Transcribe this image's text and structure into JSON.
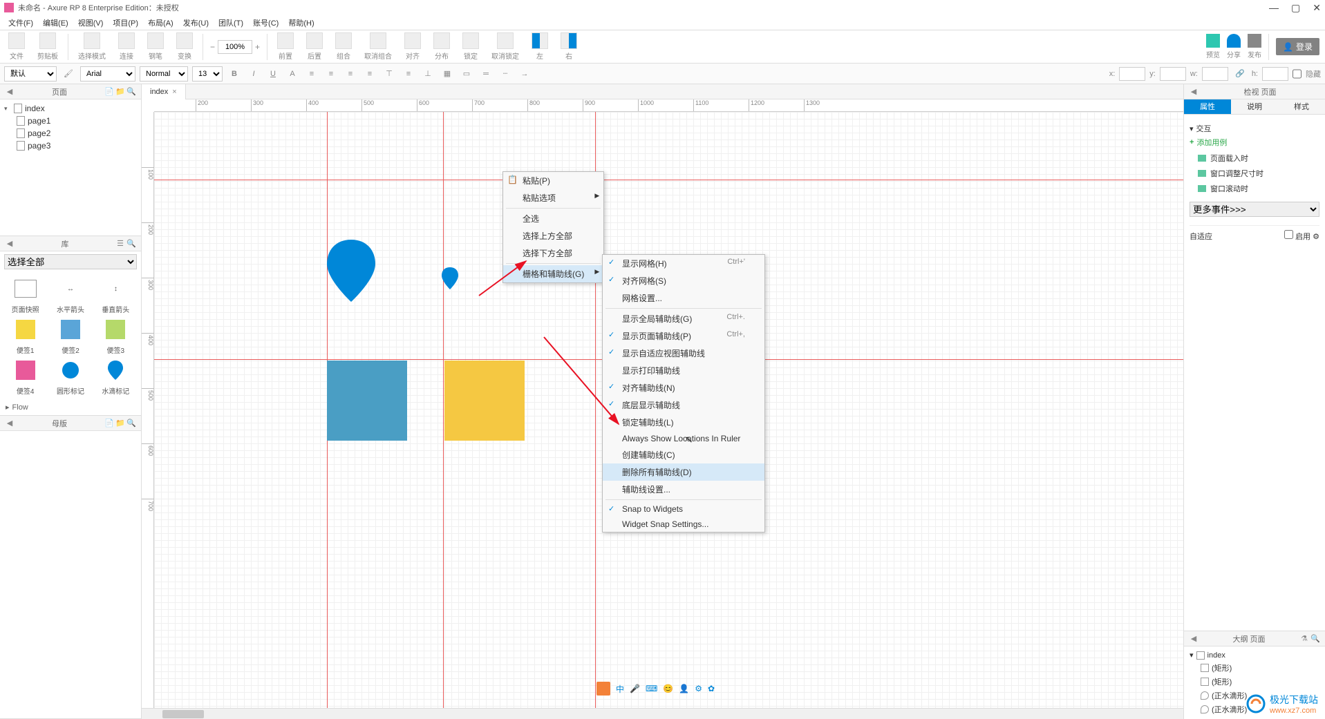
{
  "titlebar": {
    "text": "未命名 - Axure RP 8 Enterprise Edition：未授权"
  },
  "menubar": [
    "文件(F)",
    "编辑(E)",
    "视图(V)",
    "项目(P)",
    "布局(A)",
    "发布(U)",
    "团队(T)",
    "账号(C)",
    "帮助(H)"
  ],
  "toolbar": {
    "items": [
      "文件",
      "剪贴板",
      "",
      "选择模式",
      "连接",
      "钢笔",
      "变换",
      "",
      "前置",
      "后置",
      "组合",
      "取消组合",
      "对齐",
      "分布",
      "锁定",
      "取消锁定",
      "左",
      "右"
    ],
    "zoom": "100%",
    "right": [
      "预览",
      "分享",
      "发布"
    ],
    "login": "登录"
  },
  "formatbar": {
    "preset": "默认",
    "font": "Arial",
    "weight": "Normal",
    "size": "13",
    "coords": {
      "x": "x:",
      "y": "y:",
      "w": "w:",
      "h": "h:"
    },
    "hidden": "隐藏"
  },
  "pages": {
    "title": "页面",
    "root": "index",
    "children": [
      "page1",
      "page2",
      "page3"
    ]
  },
  "library": {
    "title": "库",
    "selectAll": "选择全部",
    "items": [
      {
        "label": "页面快照",
        "kind": "rect-outline"
      },
      {
        "label": "水平箭头",
        "kind": "arrow-h"
      },
      {
        "label": "垂直箭头",
        "kind": "arrow-v"
      },
      {
        "label": "便签1",
        "kind": "sticky",
        "color": "#f5d742"
      },
      {
        "label": "便签2",
        "kind": "sticky",
        "color": "#5aa5d8"
      },
      {
        "label": "便签3",
        "kind": "sticky",
        "color": "#b5d96a"
      },
      {
        "label": "便签4",
        "kind": "sticky",
        "color": "#e85a9a"
      },
      {
        "label": "圆形标记",
        "kind": "circle",
        "color": "#0087d8"
      },
      {
        "label": "水滴标记",
        "kind": "drop",
        "color": "#0087d8"
      }
    ],
    "flow": "Flow"
  },
  "masters": {
    "title": "母版"
  },
  "canvas": {
    "tab": "index",
    "rulerH": [
      200,
      300,
      400,
      500,
      600,
      700,
      800,
      900,
      1000,
      1100,
      1200,
      1300
    ],
    "rulerV": [
      100,
      200,
      300,
      400,
      500,
      600,
      700
    ]
  },
  "contextMenu1": {
    "items": [
      {
        "label": "粘贴(P)",
        "icon": true
      },
      {
        "label": "粘贴选项",
        "arrow": true
      },
      {
        "divider": true
      },
      {
        "label": "全选"
      },
      {
        "label": "选择上方全部"
      },
      {
        "label": "选择下方全部"
      },
      {
        "divider": true
      },
      {
        "label": "栅格和辅助线(G)",
        "arrow": true,
        "hl": true
      }
    ]
  },
  "contextMenu2": {
    "items": [
      {
        "label": "显示网格(H)",
        "check": true,
        "shortcut": "Ctrl+'"
      },
      {
        "label": "对齐网格(S)",
        "check": true
      },
      {
        "label": "网格设置..."
      },
      {
        "divider": true
      },
      {
        "label": "显示全局辅助线(G)",
        "shortcut": "Ctrl+."
      },
      {
        "label": "显示页面辅助线(P)",
        "check": true,
        "shortcut": "Ctrl+,"
      },
      {
        "label": "显示自适应视图辅助线",
        "check": true
      },
      {
        "label": "显示打印辅助线"
      },
      {
        "label": "对齐辅助线(N)",
        "check": true
      },
      {
        "label": "底层显示辅助线",
        "check": true
      },
      {
        "label": "锁定辅助线(L)"
      },
      {
        "label": "Always Show Locations In Ruler"
      },
      {
        "label": "创建辅助线(C)"
      },
      {
        "label": "删除所有辅助线(D)",
        "hl": true
      },
      {
        "label": "辅助线设置..."
      },
      {
        "divider": true
      },
      {
        "label": "Snap to Widgets",
        "check": true
      },
      {
        "label": "Widget Snap Settings..."
      }
    ]
  },
  "inspector": {
    "headTitle": "检视 页面",
    "tabs": [
      "属性",
      "说明",
      "样式"
    ],
    "interact": "交互",
    "addCase": "添加用例",
    "events": [
      "页面载入时",
      "窗口调整尺寸时",
      "窗口滚动时"
    ],
    "moreEvents": "更多事件>>>",
    "adaptive": "自适应",
    "enable": "启用"
  },
  "outline": {
    "title": "大纲 页面",
    "root": "index",
    "items": [
      "(矩形)",
      "(矩形)",
      "(正水滴形)",
      "(正水滴形)"
    ]
  },
  "watermark": {
    "brand": "极光下载站",
    "url": "www.xz7.com"
  }
}
